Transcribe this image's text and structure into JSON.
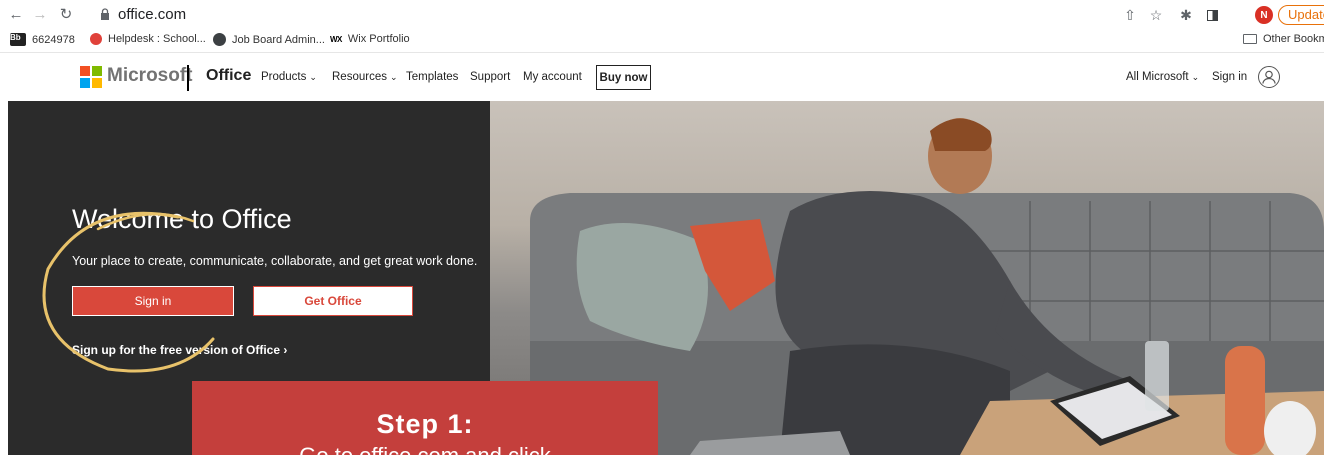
{
  "browser": {
    "url": "office.com",
    "update_label": "Update",
    "profile_initial": "N",
    "bookmarks": [
      {
        "label": "6624978",
        "icon": "bb-icon"
      },
      {
        "label": "Helpdesk : School...",
        "icon": "helpdesk-icon"
      },
      {
        "label": "Job Board Admin...",
        "icon": "globe-icon"
      },
      {
        "label": "Wix Portfolio",
        "icon": "wix-icon"
      }
    ],
    "other_bookmarks": "Other Bookm"
  },
  "header": {
    "brand": "Microsoft",
    "product": "Office",
    "nav": [
      {
        "label": "Products",
        "dropdown": true
      },
      {
        "label": "Resources",
        "dropdown": true
      },
      {
        "label": "Templates",
        "dropdown": false
      },
      {
        "label": "Support",
        "dropdown": false
      },
      {
        "label": "My account",
        "dropdown": false
      }
    ],
    "buy_now": "Buy now",
    "all_microsoft": "All Microsoft",
    "sign_in": "Sign in"
  },
  "hero": {
    "title": "Welcome to Office",
    "subtitle": "Your place to create, communicate, collaborate, and get great work done.",
    "sign_in_button": "Sign in",
    "get_office_button": "Get Office",
    "free_link": "Sign up for the free version of Office ›"
  },
  "overlay": {
    "step_title": "Step 1:",
    "step_text": "Go to office.com and click"
  },
  "colors": {
    "accent": "#d9483b",
    "hero_bg": "#2b2b2b",
    "step_box": "#c43f3c",
    "annotation": "#e8c26a"
  }
}
